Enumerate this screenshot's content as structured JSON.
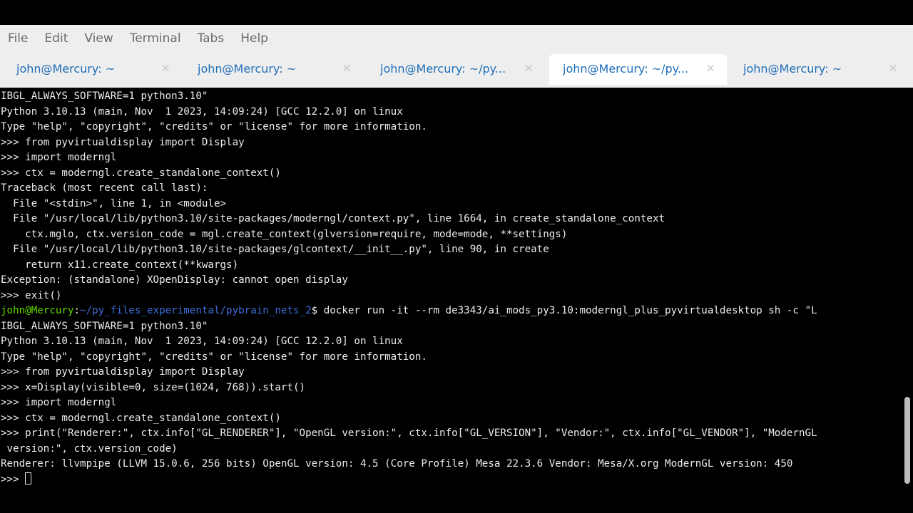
{
  "menu": {
    "file": "File",
    "edit": "Edit",
    "view": "View",
    "terminal": "Terminal",
    "tabs": "Tabs",
    "help": "Help"
  },
  "tabs": [
    {
      "label": "john@Mercury: ~",
      "close": "×"
    },
    {
      "label": "john@Mercury: ~",
      "close": "×"
    },
    {
      "label": "john@Mercury: ~/py...",
      "close": "×"
    },
    {
      "label": "john@Mercury: ~/py...",
      "close": "×"
    },
    {
      "label": "john@Mercury: ~",
      "close": "×"
    }
  ],
  "active_tab": 3,
  "terminal": {
    "lines": [
      "IBGL_ALWAYS_SOFTWARE=1 python3.10\"",
      "Python 3.10.13 (main, Nov  1 2023, 14:09:24) [GCC 12.2.0] on linux",
      "Type \"help\", \"copyright\", \"credits\" or \"license\" for more information.",
      ">>> from pyvirtualdisplay import Display",
      ">>> import moderngl",
      ">>> ctx = moderngl.create_standalone_context()",
      "Traceback (most recent call last):",
      "  File \"<stdin>\", line 1, in <module>",
      "  File \"/usr/local/lib/python3.10/site-packages/moderngl/context.py\", line 1664, in create_standalone_context",
      "    ctx.mglo, ctx.version_code = mgl.create_context(glversion=require, mode=mode, **settings)",
      "  File \"/usr/local/lib/python3.10/site-packages/glcontext/__init__.py\", line 90, in create",
      "    return x11.create_context(**kwargs)",
      "Exception: (standalone) XOpenDisplay: cannot open display",
      ">>> exit()"
    ],
    "prompt": {
      "user": "john@Mercury",
      "colon": ":",
      "path": "~/py_files_experimental/pybrain_nets_2",
      "command": "$ docker run -it --rm de3343/ai_mods_py3.10:moderngl_plus_pyvirtualdesktop sh -c \"L"
    },
    "lines_after": [
      "IBGL_ALWAYS_SOFTWARE=1 python3.10\"",
      "Python 3.10.13 (main, Nov  1 2023, 14:09:24) [GCC 12.2.0] on linux",
      "Type \"help\", \"copyright\", \"credits\" or \"license\" for more information.",
      ">>> from pyvirtualdisplay import Display",
      ">>> x=Display(visible=0, size=(1024, 768)).start()",
      ">>> import moderngl",
      ">>> ctx = moderngl.create_standalone_context()",
      ">>> print(\"Renderer:\", ctx.info[\"GL_RENDERER\"], \"OpenGL version:\", ctx.info[\"GL_VERSION\"], \"Vendor:\", ctx.info[\"GL_VENDOR\"], \"ModernGL",
      " version:\", ctx.version_code)",
      "Renderer: llvmpipe (LLVM 15.0.6, 256 bits) OpenGL version: 4.5 (Core Profile) Mesa 22.3.6 Vendor: Mesa/X.org ModernGL version: 450"
    ],
    "current_prompt": ">>> "
  },
  "colors": {
    "prompt_user": "#5fd700",
    "prompt_path": "#3d6fd9",
    "tab_text": "#1f6eb8",
    "terminal_bg": "#000000",
    "terminal_fg": "#ececec"
  }
}
